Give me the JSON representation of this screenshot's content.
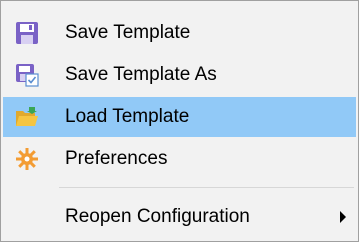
{
  "menu": {
    "items": [
      {
        "label": "Save Template",
        "icon": "save-icon"
      },
      {
        "label": "Save Template As",
        "icon": "save-as-icon"
      },
      {
        "label": "Load Template",
        "icon": "folder-open-icon",
        "highlighted": true
      },
      {
        "label": "Preferences",
        "icon": "gear-icon"
      },
      {
        "label": "Reopen Configuration",
        "icon": "",
        "has_submenu": true
      }
    ]
  },
  "colors": {
    "menu_background": "#f2f2f2",
    "highlight": "#91c9f7",
    "icon_accent": "#7a62c6",
    "folder": "#f5c542",
    "gear": "#f39c33"
  }
}
